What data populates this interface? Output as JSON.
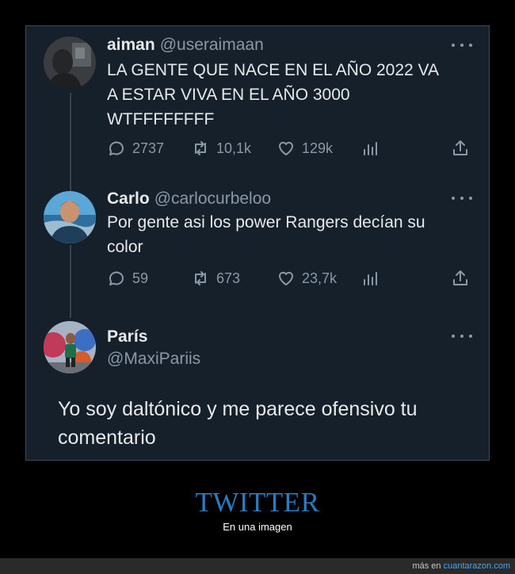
{
  "tweets": [
    {
      "name": "aiman",
      "handle": "@useraimaan",
      "lines": [
        "LA GENTE QUE NACE EN EL AÑO 2022 VA",
        "A ESTAR VIVA EN EL AÑO 3000",
        "WTFFFFFFFF"
      ],
      "stats": {
        "replies": "2737",
        "retweets": "10,1k",
        "likes": "129k"
      }
    },
    {
      "name": "Carlo",
      "handle": "@carlocurbeloo",
      "lines": [
        "Por gente asi los power Rangers decían su",
        "color"
      ],
      "stats": {
        "replies": "59",
        "retweets": "673",
        "likes": "23,7k"
      }
    },
    {
      "name": "París",
      "handle": "@MaxiPariis",
      "lines": [
        "Yo soy daltónico y me parece ofensivo tu",
        "comentario"
      ]
    }
  ],
  "icons": {
    "reply": "reply-icon",
    "retweet": "retweet-icon",
    "like": "like-icon",
    "views": "views-icon",
    "share": "share-icon",
    "more": "more-icon"
  },
  "brand": {
    "title": "TWITTER",
    "subtitle": "En una imagen"
  },
  "footer": {
    "prefix": "más en",
    "site": "cuantarazon.com"
  },
  "colors": {
    "tweet_bg": "#15202b",
    "text": "#e7e9ea",
    "muted": "#8b98a5",
    "brand": "#2a7bbf",
    "link": "#4aa3e8"
  }
}
